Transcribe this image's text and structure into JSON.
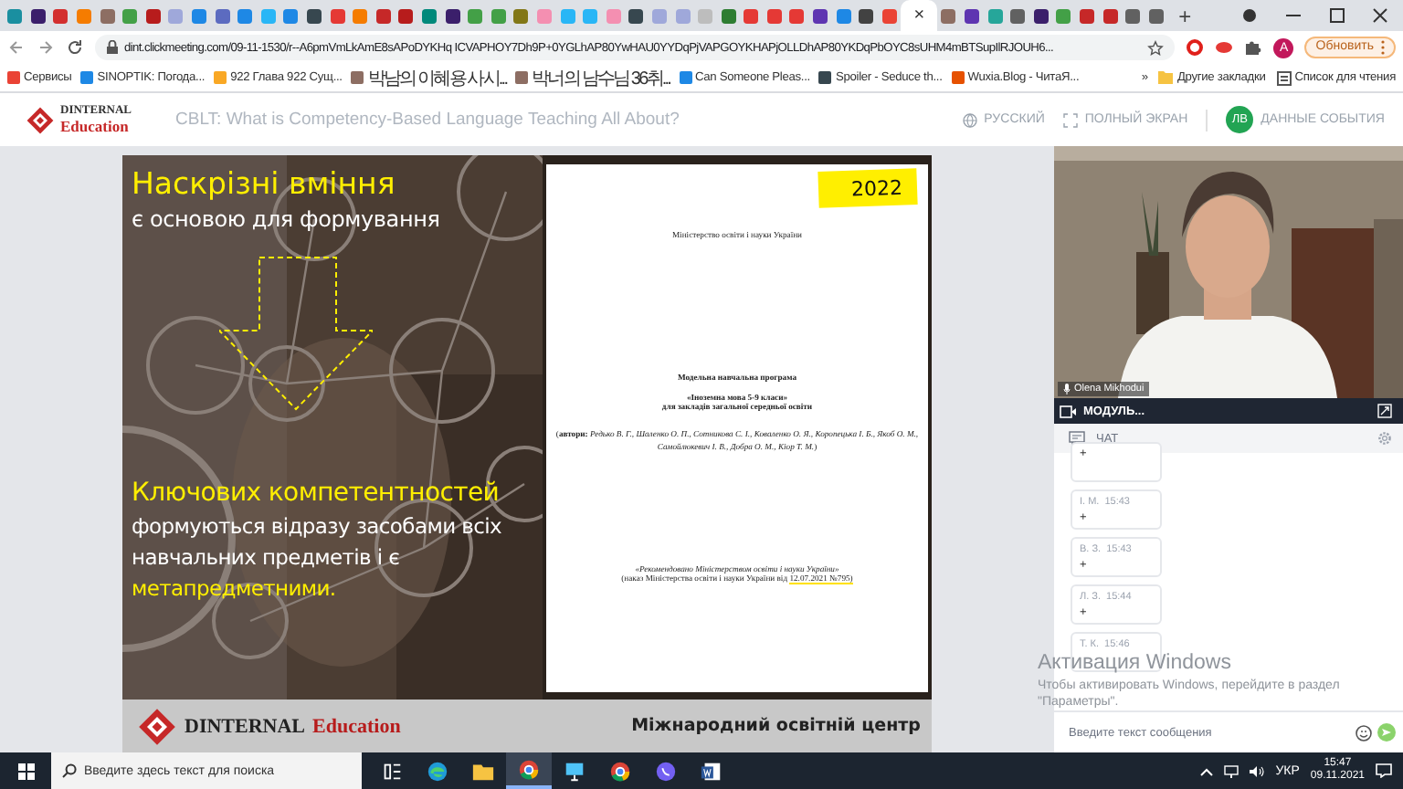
{
  "browser": {
    "tabs": [
      {
        "color": "#1a8fa0",
        "selected": false
      },
      {
        "color": "#3b1f6b",
        "selected": false
      },
      {
        "color": "#d32f2f",
        "selected": false
      },
      {
        "color": "#f57c00",
        "selected": false
      },
      {
        "color": "#8d6e63",
        "selected": false
      },
      {
        "color": "#43a047",
        "selected": false
      },
      {
        "color": "#b71c1c",
        "selected": false
      },
      {
        "color": "#9fa8da",
        "selected": false
      },
      {
        "color": "#1e88e5",
        "selected": false
      },
      {
        "color": "#5c6bc0",
        "selected": false
      },
      {
        "color": "#1e88e5",
        "selected": false
      },
      {
        "color": "#29b6f6",
        "selected": false
      },
      {
        "color": "#1e88e5",
        "selected": false
      },
      {
        "color": "#37474f",
        "selected": false
      },
      {
        "color": "#e53935",
        "selected": false
      },
      {
        "color": "#f57c00",
        "selected": false
      },
      {
        "color": "#c62828",
        "selected": false
      },
      {
        "color": "#b71c1c",
        "selected": false
      },
      {
        "color": "#00897b",
        "selected": false
      },
      {
        "color": "#3b1f6b",
        "selected": false
      },
      {
        "color": "#43a047",
        "selected": false
      },
      {
        "color": "#43a047",
        "selected": false
      },
      {
        "color": "#827717",
        "selected": false
      },
      {
        "color": "#f48fb1",
        "selected": false
      },
      {
        "color": "#29b6f6",
        "selected": false
      },
      {
        "color": "#29b6f6",
        "selected": false
      },
      {
        "color": "#f48fb1",
        "selected": false
      },
      {
        "color": "#37474f",
        "selected": false
      },
      {
        "color": "#9fa8da",
        "selected": false
      },
      {
        "color": "#9fa8da",
        "selected": false
      },
      {
        "color": "#bdbdbd",
        "selected": false
      },
      {
        "color": "#2e7d32",
        "selected": false
      },
      {
        "color": "#e53935",
        "selected": false
      },
      {
        "color": "#e53935",
        "selected": false
      },
      {
        "color": "#e53935",
        "selected": false
      },
      {
        "color": "#5e35b1",
        "selected": false
      },
      {
        "color": "#1e88e5",
        "selected": false
      },
      {
        "color": "#424242",
        "selected": false
      },
      {
        "color": "#ea4335",
        "selected": false
      },
      {
        "selected": true
      },
      {
        "color": "#8d6e63",
        "selected": false
      },
      {
        "color": "#5e35b1",
        "selected": false
      },
      {
        "color": "#26a69a",
        "selected": false
      },
      {
        "color": "#616161",
        "selected": false
      },
      {
        "color": "#3b1f6b",
        "selected": false
      },
      {
        "color": "#43a047",
        "selected": false
      },
      {
        "color": "#c62828",
        "selected": false
      },
      {
        "color": "#c62828",
        "selected": false
      },
      {
        "color": "#616161",
        "selected": false
      },
      {
        "color": "#616161",
        "selected": false
      }
    ],
    "tab_close": "×",
    "new_tab": "+",
    "url": "dint.clickmeeting.com/09-11-1530/r--A6pmVmLkAmE8sAPoDYKHq ICVAPHOY7Dh9P+0YGLhAP80YwHAU0YYDqPjVAPGOYKHAPjOLLDhAP80YKDqPbOYC8sUHM4mBTSupIlRJOUH6...",
    "profile": "A",
    "update_button": "Обновить",
    "bookmarks": [
      {
        "label": "Сервисы",
        "color": "#ea4335"
      },
      {
        "label": "SINOPTIK: Погода...",
        "color": "#1e88e5"
      },
      {
        "label": "922 Глава 922 Сущ...",
        "color": "#f9a825"
      },
      {
        "label": "박남의 이혜용 사시...",
        "color": "#8d6e63"
      },
      {
        "label": "박너의 남수님 36취...",
        "color": "#8d6e63"
      },
      {
        "label": "Can Someone Pleas...",
        "color": "#1e88e5"
      },
      {
        "label": "Spoiler - Seduce th...",
        "color": "#37474f"
      },
      {
        "label": "Wuxia.Blog - ЧитаЯ...",
        "color": "#e65100"
      }
    ],
    "more_bookmarks": "»",
    "other_bookmarks": "Другие закладки",
    "reading_list": "Список для чтения"
  },
  "header": {
    "logo_top": "DINTERNAL",
    "logo_bottom": "Education",
    "title": "CBLT: What is Competency-Based Language Teaching All About?",
    "language": "РУССКИЙ",
    "fullscreen": "ПОЛНЫЙ ЭКРАН",
    "avatar": "ЛВ",
    "event_data": "ДАННЫЕ СОБЫТИЯ"
  },
  "slide": {
    "heading": "Наскрізні вміння",
    "subheading": "є основою для формування",
    "key_title": "Ключових компетентностей",
    "key_text": "формуються відразу засобами всіх навчальних предметів і є",
    "key_highlight": "метапредметними.",
    "document": {
      "year": "2022",
      "ministry": "Міністерство освіти і науки України",
      "program": "Модельна навчальна програма",
      "subject": "«Іноземна мова  5-9 класи»",
      "audience": "для закладів загальної середньої освіти",
      "authors": "(**автори:** *Редько В. Г., Шаленко О. П., Сотникова С. І., Коваленко О. Я., Коропецька І. Б., Якоб О. М., Самойлюкевич І. В., Добра О. М., Кіор Т. М.*)",
      "recommended": "«Рекомендовано Міністерством освіти і науки України»",
      "order_prefix": "(наказ Міністерства освіти і науки України від ",
      "order_date": "12.07.2021 №795)"
    },
    "footer_brand": "DINTERNAL",
    "footer_brand_accent": "Education",
    "footer_text": "Міжнародний освітній центр"
  },
  "video": {
    "speaker": "Olena Mikhodui",
    "module": "МОДУЛЬ..."
  },
  "chat": {
    "title": "ЧАТ",
    "messages": [
      {
        "text": "+"
      },
      {
        "author": "І. М.",
        "time": "15:43",
        "text": "+"
      },
      {
        "author": "В. З.",
        "time": "15:43",
        "text": "+"
      },
      {
        "author": "Л. З.",
        "time": "15:44",
        "text": "+"
      },
      {
        "author": "Т. К.",
        "time": "15:46"
      }
    ],
    "placeholder": "Введите текст сообщения"
  },
  "activation": {
    "title": "Активация Windows",
    "line1": "Чтобы активировать Windows, перейдите в раздел",
    "line2": "\"Параметры\"."
  },
  "taskbar": {
    "search_placeholder": "Введите здесь текст для поиска",
    "apps": [
      {
        "kind": "taskview",
        "selected": false
      },
      {
        "kind": "edge",
        "selected": false
      },
      {
        "kind": "folder",
        "selected": false
      },
      {
        "kind": "chrome",
        "selected": true
      },
      {
        "kind": "monitor",
        "selected": false
      },
      {
        "kind": "chrome",
        "selected": false
      },
      {
        "kind": "viber",
        "selected": false
      },
      {
        "kind": "word",
        "selected": false
      }
    ],
    "language": "УКР",
    "time": "15:47",
    "date": "09.11.2021"
  }
}
